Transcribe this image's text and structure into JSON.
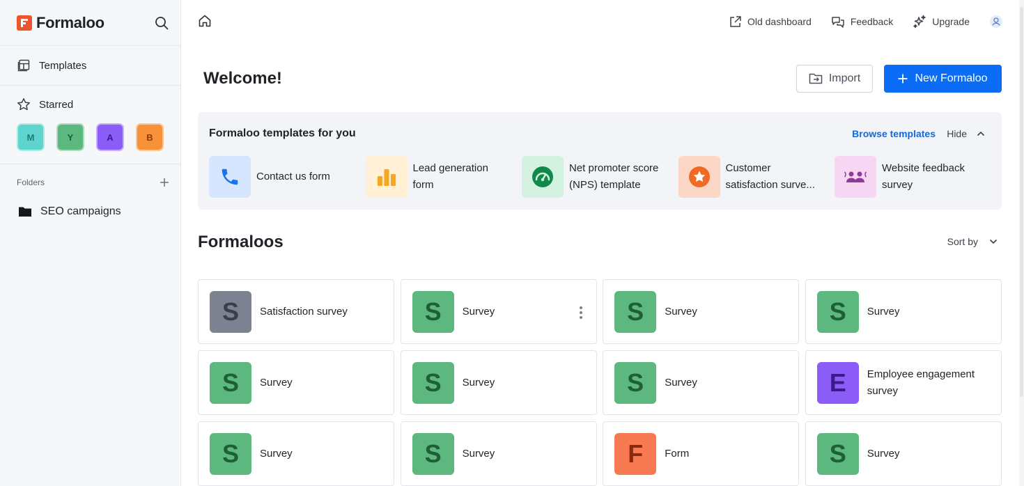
{
  "app": {
    "name": "Formaloo"
  },
  "sidebar": {
    "templates_label": "Templates",
    "starred_label": "Starred",
    "starred_items": [
      {
        "letter": "M",
        "bg": "#5fd4cf",
        "fg": "#1d7b77"
      },
      {
        "letter": "Y",
        "bg": "#5cb87e",
        "fg": "#1f5f38"
      },
      {
        "letter": "A",
        "bg": "#8b5cf6",
        "fg": "#3b1a8a"
      },
      {
        "letter": "B",
        "bg": "#f7923b",
        "fg": "#8a3b06"
      }
    ],
    "folders_label": "Folders",
    "folders": [
      {
        "name": "SEO campaigns"
      }
    ]
  },
  "topbar": {
    "old_dashboard": "Old dashboard",
    "feedback": "Feedback",
    "upgrade": "Upgrade"
  },
  "main": {
    "welcome": "Welcome!",
    "import_label": "Import",
    "new_label": "New Formaloo",
    "templates_panel": {
      "title": "Formaloo templates for you",
      "browse": "Browse templates",
      "hide": "Hide",
      "items": [
        {
          "label": "Contact us form",
          "icon": "phone-icon",
          "bg": "#d6e6ff",
          "color": "#1a73e8"
        },
        {
          "label": "Lead generation form",
          "icon": "bar-chart-icon",
          "bg": "#fff0d6",
          "color": "#f5a623"
        },
        {
          "label": "Net promoter score (NPS) template",
          "icon": "gauge-icon",
          "bg": "#d3f2e0",
          "color": "#0f8a4b"
        },
        {
          "label": "Customer satisfaction surve...",
          "icon": "star-badge-icon",
          "bg": "#fcd7c6",
          "color": "#f06a25"
        },
        {
          "label": "Website feedback survey",
          "icon": "people-talk-icon",
          "bg": "#f6d6f3",
          "color": "#8e3a9a"
        }
      ]
    },
    "formaloos_title": "Formaloos",
    "sort_label": "Sort by",
    "formaloos": [
      {
        "letter": "S",
        "label": "Satisfaction survey",
        "bg": "#7c828f",
        "fg": "#3a3f49"
      },
      {
        "letter": "S",
        "label": "Survey",
        "bg": "#5cb87e",
        "fg": "#1f5f38"
      },
      {
        "letter": "S",
        "label": "Survey",
        "bg": "#5cb87e",
        "fg": "#1f5f38"
      },
      {
        "letter": "S",
        "label": "Survey",
        "bg": "#5cb87e",
        "fg": "#1f5f38"
      },
      {
        "letter": "S",
        "label": "Survey",
        "bg": "#5cb87e",
        "fg": "#1f5f38"
      },
      {
        "letter": "S",
        "label": "Survey",
        "bg": "#5cb87e",
        "fg": "#1f5f38"
      },
      {
        "letter": "S",
        "label": "Survey",
        "bg": "#5cb87e",
        "fg": "#1f5f38"
      },
      {
        "letter": "E",
        "label": "Employee engagement survey",
        "bg": "#8b5cf6",
        "fg": "#3b1a8a"
      },
      {
        "letter": "S",
        "label": "Survey",
        "bg": "#5cb87e",
        "fg": "#1f5f38"
      },
      {
        "letter": "S",
        "label": "Survey",
        "bg": "#5cb87e",
        "fg": "#1f5f38"
      },
      {
        "letter": "F",
        "label": "Form",
        "bg": "#f77a52",
        "fg": "#8a2a0c"
      },
      {
        "letter": "S",
        "label": "Survey",
        "bg": "#5cb87e",
        "fg": "#1f5f38"
      }
    ]
  }
}
